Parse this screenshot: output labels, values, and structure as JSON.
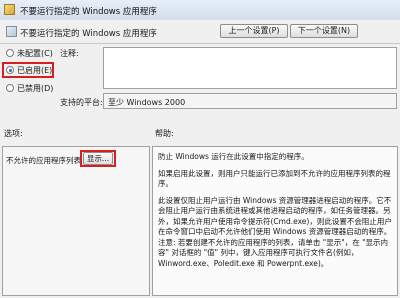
{
  "window": {
    "title": "不要运行指定的 Windows 应用程序",
    "header": "不要运行指定的 Windows 应用程序"
  },
  "nav": {
    "prev_label": "上一个设置(P)",
    "next_label": "下一个设置(N)"
  },
  "radios": [
    {
      "label": "未配置(C)",
      "selected": false
    },
    {
      "label": "已启用(E)",
      "selected": true
    },
    {
      "label": "已禁用(D)",
      "selected": false
    }
  ],
  "comment": {
    "label": "注释:",
    "value": ""
  },
  "platform": {
    "label": "支持的平台:",
    "value": "至少 Windows 2000"
  },
  "options": {
    "section_label": "选项:",
    "list_label": "不允许的应用程序列表",
    "show_button": "显示..."
  },
  "help": {
    "section_label": "帮助:",
    "paragraphs": [
      "防止 Windows 运行在此设置中指定的程序。",
      "如果启用此设置，则用户只能运行已添加到不允许的应用程序列表的程序。",
      "此设置仅阻止用户运行由 Windows 资源管理器进程启动的程序。它不会阻止用户运行由系统进程或其他进程启动的程序，如任务管理器。另外，如果允许用户使用命令提示符(Cmd.exe)，则此设置不会阻止用户在命令窗口中启动不允许他们使用 Windows 资源管理器启动的程序。注意: 若要创建不允许的应用程序的列表，请单击 \"显示\"，在 \"显示内容\" 对话框的 \"值\" 列中，键入应用程序可执行文件名(例如，Winword.exe、Poledit.exe 和 Powerpnt.exe)。"
    ]
  }
}
